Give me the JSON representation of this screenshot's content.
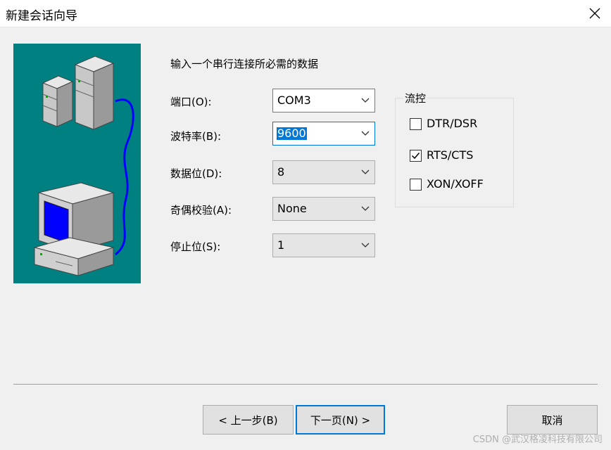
{
  "window": {
    "title": "新建会话向导",
    "close_glyph": "✕"
  },
  "main": {
    "intro": "输入一个串行连接所必需的数据",
    "fields": [
      {
        "label": "端口(O):",
        "value": "COM3"
      },
      {
        "label": "波特率(B):",
        "value": "9600"
      },
      {
        "label": "数据位(D):",
        "value": "8"
      },
      {
        "label": "奇偶校验(A):",
        "value": "None"
      },
      {
        "label": "停止位(S):",
        "value": "1"
      }
    ]
  },
  "flow_control": {
    "title": "流控",
    "options": [
      {
        "label": "DTR/DSR",
        "checked": false
      },
      {
        "label": "RTS/CTS",
        "checked": true
      },
      {
        "label": "XON/XOFF",
        "checked": false
      }
    ]
  },
  "buttons": {
    "back": "< 上一步(B)",
    "next": "下一页(N) >",
    "cancel": "取消"
  },
  "watermark": "CSDN @武汉格凌科技有限公司",
  "colors": {
    "illustration_bg": "#008080",
    "accent": "#0078d7",
    "cable": "#0000ff",
    "screen": "#0000ff"
  },
  "icons": {
    "illustration": "servers-and-computer-illustration",
    "dropdown": "chevron-down-icon",
    "close": "close-icon",
    "check": "checkmark-icon"
  }
}
